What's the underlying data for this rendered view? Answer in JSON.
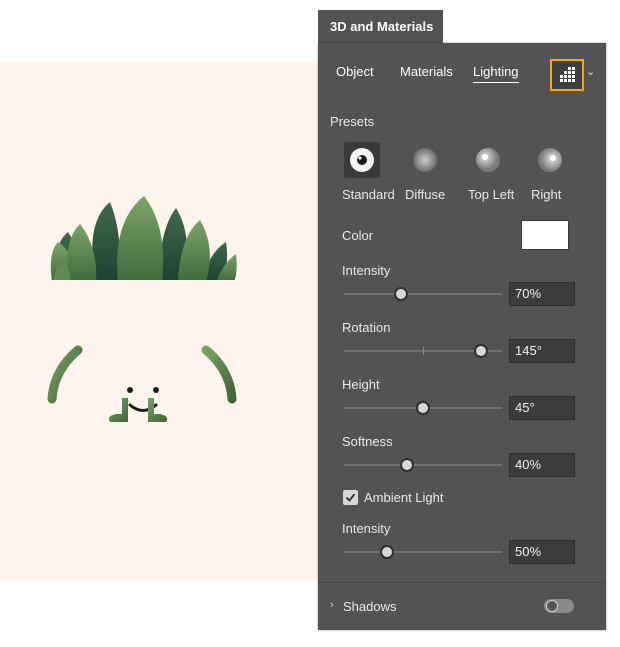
{
  "panel": {
    "title": "3D and Materials",
    "tabs": [
      {
        "label": "Object"
      },
      {
        "label": "Materials"
      },
      {
        "label": "Lighting",
        "active": true
      }
    ],
    "lighting_button_icon": "light-grid-icon",
    "dropdown_icon": "chevron-down-icon",
    "accent_color": "#f0a81c"
  },
  "presets": {
    "heading": "Presets",
    "items": [
      {
        "label": "Standard",
        "selected": true
      },
      {
        "label": "Diffuse"
      },
      {
        "label": "Top Left"
      },
      {
        "label": "Right"
      }
    ]
  },
  "light": {
    "color_label": "Color",
    "color_value": "#ffffff",
    "intensity": {
      "label": "Intensity",
      "value": "70%",
      "fraction": 0.36
    },
    "rotation": {
      "label": "Rotation",
      "value": "145°",
      "fraction": 0.87
    },
    "height": {
      "label": "Height",
      "value": "45°",
      "fraction": 0.5
    },
    "softness": {
      "label": "Softness",
      "value": "40%",
      "fraction": 0.4
    }
  },
  "ambient": {
    "label": "Ambient Light",
    "checked": true,
    "intensity": {
      "label": "Intensity",
      "value": "50%",
      "fraction": 0.27
    }
  },
  "shadows": {
    "label": "Shadows",
    "enabled": false
  },
  "artwork": {
    "description_icon": "succulent-character-illustration"
  }
}
